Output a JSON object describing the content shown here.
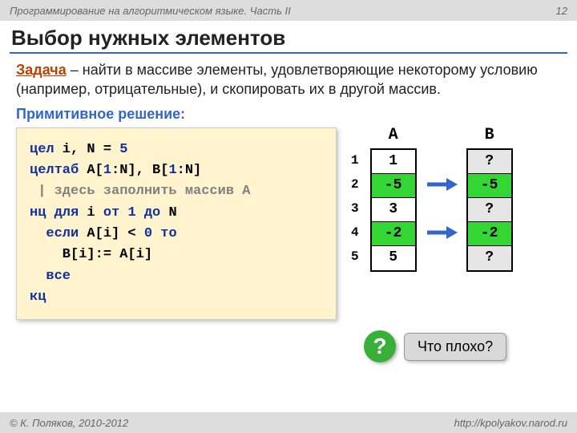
{
  "header": {
    "left": "Программирование на алгоритмическом языке. Часть II",
    "right": "12"
  },
  "title": "Выбор нужных элементов",
  "task": {
    "label": "Задача",
    "text": " – найти в массиве элементы, удовлетворяющие некоторому условию (например, отрицательные), и скопировать их в другой массив."
  },
  "primitive_label": "Примитивное решение:",
  "code": {
    "l1a": "цел",
    "l1b": " i, N",
    "l1c": " = ",
    "l1d": "5",
    "l2a": "целтаб",
    "l2b": " A[",
    "l2c": "1",
    "l2d": ":N], B[",
    "l2e": "1",
    "l2f": ":N]",
    "l3": " | здесь заполнить массив A",
    "l4a": "нц для",
    "l4b": " i ",
    "l4c": "от ",
    "l4d": "1",
    "l4e": " до",
    "l4f": " N",
    "l5a": "  если",
    "l5b": " A[i] < ",
    "l5c": "0",
    "l5d": " то",
    "l6": "    B[i]:= A[i]",
    "l7": "  все",
    "l8": "кц"
  },
  "arrays": {
    "idx": [
      "1",
      "2",
      "3",
      "4",
      "5"
    ],
    "A": {
      "head": "A",
      "cells": [
        "1",
        "-5",
        "3",
        "-2",
        "5"
      ],
      "green": [
        1,
        3
      ]
    },
    "B": {
      "head": "B",
      "cells": [
        "?",
        "-5",
        "?",
        "-2",
        "?"
      ],
      "green": [
        1,
        3
      ],
      "gray": [
        0,
        2,
        4
      ]
    },
    "arrows": [
      false,
      true,
      false,
      true,
      false
    ]
  },
  "question": {
    "mark": "?",
    "text": "Что плохо?"
  },
  "footer": {
    "left": "© К. Поляков, 2010-2012",
    "right": "http://kpolyakov.narod.ru"
  }
}
